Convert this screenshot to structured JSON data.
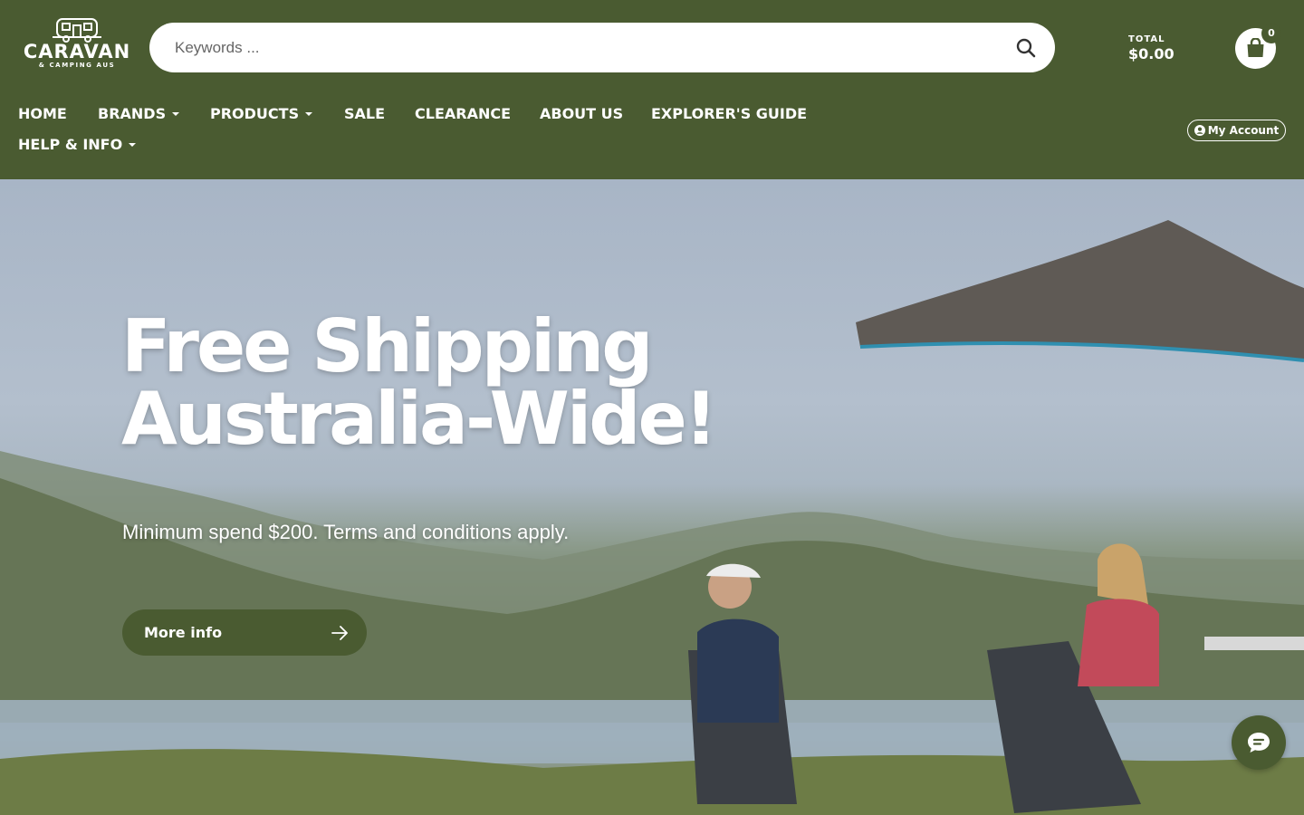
{
  "header": {
    "logo": {
      "word": "CARAVAN",
      "sub": "& CAMPING AUS"
    },
    "search": {
      "placeholder": "Keywords ...",
      "value": ""
    },
    "cart": {
      "total_label": "TOTAL",
      "total_value": "$0.00",
      "count": "0"
    },
    "account_label": "My Account"
  },
  "nav": {
    "items": [
      {
        "label": "HOME",
        "has_dropdown": false
      },
      {
        "label": "BRANDS",
        "has_dropdown": true
      },
      {
        "label": "PRODUCTS",
        "has_dropdown": true
      },
      {
        "label": "SALE",
        "has_dropdown": false
      },
      {
        "label": "CLEARANCE",
        "has_dropdown": false
      },
      {
        "label": "ABOUT US",
        "has_dropdown": false
      },
      {
        "label": "EXPLORER'S GUIDE",
        "has_dropdown": false
      },
      {
        "label": "HELP & INFO",
        "has_dropdown": true
      }
    ]
  },
  "hero": {
    "title_line1": "Free Shipping",
    "title_line2": "Australia-Wide!",
    "subtitle": "Minimum spend $200. Terms and conditions apply.",
    "button_label": "More info"
  },
  "colors": {
    "brand_green": "#4a5b31",
    "white": "#ffffff"
  },
  "icons": {
    "search": "search-icon",
    "cart": "shopping-bag-icon",
    "account": "user-circle-icon",
    "button_arrow": "arrow-right-icon",
    "chat": "chat-bubble-icon"
  }
}
